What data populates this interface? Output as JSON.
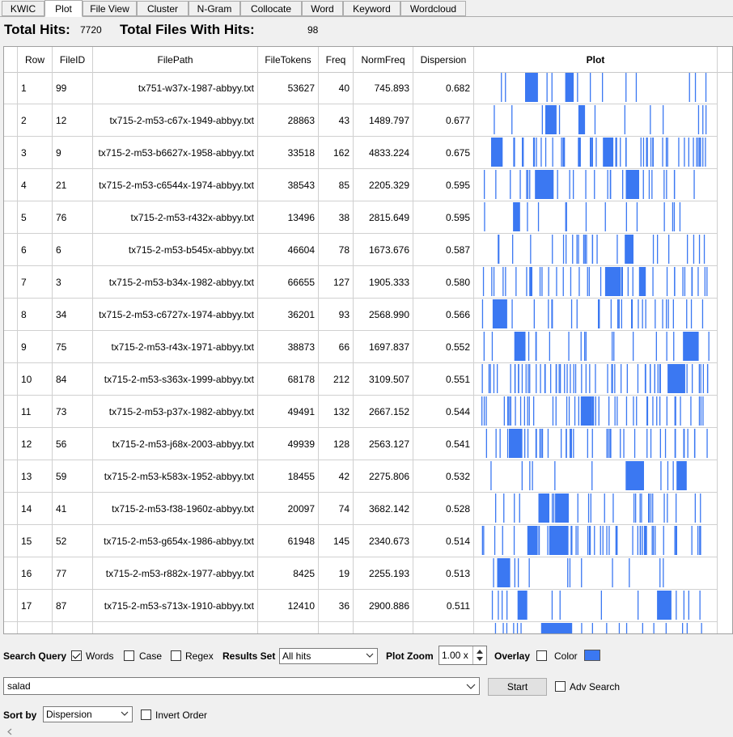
{
  "tabs": [
    "KWIC",
    "Plot",
    "File View",
    "Cluster",
    "N-Gram",
    "Collocate",
    "Word",
    "Keyword",
    "Wordcloud"
  ],
  "active_tab": "Plot",
  "stats": {
    "total_hits_label": "Total Hits:",
    "total_hits_value": "7720",
    "total_files_label": "Total Files With Hits:",
    "total_files_value": "98"
  },
  "table": {
    "columns": [
      "Row",
      "FileID",
      "FilePath",
      "FileTokens",
      "Freq",
      "NormFreq",
      "Dispersion",
      "Plot"
    ],
    "rows": [
      {
        "row": "1",
        "fileid": "99",
        "filepath": "tx751-w37x-1987-abbyy.txt",
        "tokens": "53627",
        "freq": "40",
        "normfreq": "745.893",
        "dispersion": "0.682"
      },
      {
        "row": "2",
        "fileid": "12",
        "filepath": "tx715-2-m53-c67x-1949-abbyy.txt",
        "tokens": "28863",
        "freq": "43",
        "normfreq": "1489.797",
        "dispersion": "0.677"
      },
      {
        "row": "3",
        "fileid": "9",
        "filepath": "tx715-2-m53-b6627x-1958-abbyy.txt",
        "tokens": "33518",
        "freq": "162",
        "normfreq": "4833.224",
        "dispersion": "0.675"
      },
      {
        "row": "4",
        "fileid": "21",
        "filepath": "tx715-2-m53-c6544x-1974-abbyy.txt",
        "tokens": "38543",
        "freq": "85",
        "normfreq": "2205.329",
        "dispersion": "0.595"
      },
      {
        "row": "5",
        "fileid": "76",
        "filepath": "tx715-2-m53-r432x-abbyy.txt",
        "tokens": "13496",
        "freq": "38",
        "normfreq": "2815.649",
        "dispersion": "0.595"
      },
      {
        "row": "6",
        "fileid": "6",
        "filepath": "tx715-2-m53-b545x-abbyy.txt",
        "tokens": "46604",
        "freq": "78",
        "normfreq": "1673.676",
        "dispersion": "0.587"
      },
      {
        "row": "7",
        "fileid": "3",
        "filepath": "tx715-2-m53-b34x-1982-abbyy.txt",
        "tokens": "66655",
        "freq": "127",
        "normfreq": "1905.333",
        "dispersion": "0.580"
      },
      {
        "row": "8",
        "fileid": "34",
        "filepath": "tx715-2-m53-c6727x-1974-abbyy.txt",
        "tokens": "36201",
        "freq": "93",
        "normfreq": "2568.990",
        "dispersion": "0.566"
      },
      {
        "row": "9",
        "fileid": "75",
        "filepath": "tx715-2-m53-r43x-1971-abbyy.txt",
        "tokens": "38873",
        "freq": "66",
        "normfreq": "1697.837",
        "dispersion": "0.552"
      },
      {
        "row": "10",
        "fileid": "84",
        "filepath": "tx715-2-m53-s363x-1999-abbyy.txt",
        "tokens": "68178",
        "freq": "212",
        "normfreq": "3109.507",
        "dispersion": "0.551"
      },
      {
        "row": "11",
        "fileid": "73",
        "filepath": "tx715-2-m53-p37x-1982-abbyy.txt",
        "tokens": "49491",
        "freq": "132",
        "normfreq": "2667.152",
        "dispersion": "0.544"
      },
      {
        "row": "12",
        "fileid": "56",
        "filepath": "tx715-2-m53-j68x-2003-abbyy.txt",
        "tokens": "49939",
        "freq": "128",
        "normfreq": "2563.127",
        "dispersion": "0.541"
      },
      {
        "row": "13",
        "fileid": "59",
        "filepath": "tx715-2-m53-k583x-1952-abbyy.txt",
        "tokens": "18455",
        "freq": "42",
        "normfreq": "2275.806",
        "dispersion": "0.532"
      },
      {
        "row": "14",
        "fileid": "41",
        "filepath": "tx715-2-m53-f38-1960z-abbyy.txt",
        "tokens": "20097",
        "freq": "74",
        "normfreq": "3682.142",
        "dispersion": "0.528"
      },
      {
        "row": "15",
        "fileid": "52",
        "filepath": "tx715-2-m53-g654x-1986-abbyy.txt",
        "tokens": "61948",
        "freq": "145",
        "normfreq": "2340.673",
        "dispersion": "0.514"
      },
      {
        "row": "16",
        "fileid": "77",
        "filepath": "tx715-2-m53-r882x-1977-abbyy.txt",
        "tokens": "8425",
        "freq": "19",
        "normfreq": "2255.193",
        "dispersion": "0.513"
      },
      {
        "row": "17",
        "fileid": "87",
        "filepath": "tx715-2-m53-s713x-1910-abbyy.txt",
        "tokens": "12410",
        "freq": "36",
        "normfreq": "2900.886",
        "dispersion": "0.511"
      }
    ]
  },
  "plot_color": "#3b78f2",
  "controls": {
    "search_query_label": "Search Query",
    "words_label": "Words",
    "words_checked": true,
    "case_label": "Case",
    "regex_label": "Regex",
    "results_set_label": "Results Set",
    "results_set_value": "All hits",
    "plot_zoom_label": "Plot Zoom",
    "plot_zoom_value": "1.00 x",
    "overlay_label": "Overlay",
    "color_label": "Color",
    "query_value": "salad",
    "start_label": "Start",
    "adv_search_label": "Adv Search",
    "sort_by_label": "Sort by",
    "sort_by_value": "Dispersion",
    "invert_order_label": "Invert Order"
  }
}
